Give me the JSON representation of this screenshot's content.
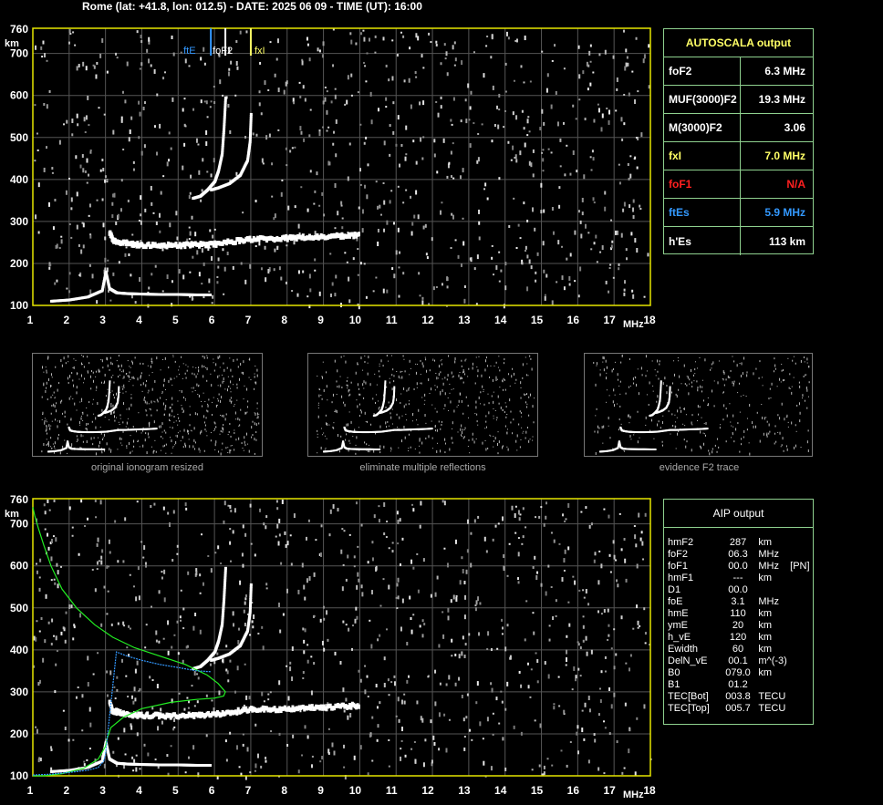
{
  "header": "Rome (lat: +41.8, lon: 012.5) - DATE: 2025 06 09 - TIME (UT): 16:00",
  "colors": {
    "frame": "#e6e600",
    "grid": "#555555",
    "panel": "#8fd18f",
    "yellow": "#ffff66",
    "red": "#ff2020",
    "blue": "#3399ff",
    "green": "#22ee22"
  },
  "chart_data": [
    {
      "type": "scatter",
      "name": "main-ionogram",
      "ylabel": "km",
      "xlabel": "MHz",
      "xlim": [
        1,
        18
      ],
      "ylim": [
        100,
        760
      ],
      "xticks": [
        1,
        2,
        3,
        4,
        5,
        6,
        7,
        8,
        9,
        10,
        11,
        12,
        13,
        14,
        15,
        16,
        17,
        18
      ],
      "yticks": [
        100,
        200,
        300,
        400,
        500,
        600,
        700,
        760
      ],
      "markers": [
        {
          "label": "ftE",
          "x": 5.9,
          "color": "#3399ff"
        },
        {
          "label": "foF2",
          "x": 6.3,
          "color": "#ffffff"
        },
        {
          "label": "fxI",
          "x": 7.0,
          "color": "#ffff66"
        }
      ],
      "traces": [
        {
          "name": "E",
          "x": [
            1.5,
            2,
            2.5,
            2.9,
            3.0,
            3.1,
            3.3,
            3.6,
            4,
            4.5,
            5,
            5.5,
            5.9
          ],
          "y": [
            110,
            113,
            120,
            135,
            180,
            140,
            130,
            128,
            127,
            126,
            126,
            125,
            125
          ]
        },
        {
          "name": "F-low",
          "x": [
            3.1,
            3.2,
            3.4,
            3.7,
            4,
            4.5,
            5,
            5.5,
            6,
            6.5,
            7,
            7.5,
            8,
            8.5,
            9,
            9.5,
            10
          ],
          "y": [
            275,
            255,
            250,
            246,
            244,
            243,
            243,
            244,
            246,
            252,
            258,
            258,
            260,
            262,
            263,
            265,
            268
          ]
        },
        {
          "name": "O-trace",
          "x": [
            5.4,
            5.6,
            5.8,
            6.0,
            6.1,
            6.2,
            6.25,
            6.3
          ],
          "y": [
            355,
            360,
            375,
            395,
            420,
            460,
            520,
            600
          ]
        },
        {
          "name": "X-trace",
          "x": [
            5.9,
            6.1,
            6.4,
            6.7,
            6.9,
            6.97,
            7.0
          ],
          "y": [
            375,
            380,
            390,
            410,
            445,
            490,
            560
          ]
        }
      ]
    },
    {
      "type": "line",
      "name": "aip-profile",
      "ylabel": "km",
      "xlabel": "MHz",
      "xlim": [
        1,
        18
      ],
      "ylim": [
        100,
        760
      ],
      "xticks": [
        1,
        2,
        3,
        4,
        5,
        6,
        7,
        8,
        9,
        10,
        11,
        12,
        13,
        14,
        15,
        16,
        17,
        18
      ],
      "yticks": [
        100,
        200,
        300,
        400,
        500,
        600,
        700,
        760
      ],
      "series": [
        {
          "color": "#22ee22",
          "x": [
            1.0,
            1.05,
            1.15,
            1.3,
            1.5,
            1.8,
            2.2,
            2.7,
            3.2,
            3.8,
            4.5,
            5.2,
            5.8,
            6.1,
            6.3,
            6.25,
            6.0,
            5.5,
            4.8,
            4.0,
            3.5,
            3.15,
            3.05,
            3.0,
            2.8,
            2.4,
            1.8,
            1.3,
            1.0
          ],
          "y": [
            740,
            720,
            690,
            650,
            600,
            545,
            500,
            460,
            430,
            405,
            385,
            365,
            340,
            320,
            300,
            290,
            285,
            282,
            275,
            260,
            240,
            215,
            190,
            170,
            140,
            118,
            105,
            100,
            100
          ]
        },
        {
          "color": "#3399ff",
          "x": [
            1.0,
            1.5,
            2.0,
            2.5,
            2.8,
            2.95,
            3.0,
            3.3,
            3.6,
            4.0,
            4.5,
            5.0,
            5.5,
            5.9
          ],
          "y": [
            102,
            104,
            108,
            113,
            120,
            135,
            150,
            395,
            385,
            375,
            365,
            358,
            350,
            348
          ]
        }
      ],
      "traces": [
        {
          "name": "E",
          "x": [
            1.5,
            2,
            2.5,
            2.9,
            3.0,
            3.1,
            3.3,
            3.6,
            4,
            4.5,
            5,
            5.5,
            5.9
          ],
          "y": [
            110,
            113,
            120,
            135,
            180,
            140,
            130,
            128,
            127,
            126,
            126,
            125,
            125
          ]
        },
        {
          "name": "F-low",
          "x": [
            3.1,
            3.2,
            3.4,
            3.7,
            4,
            4.5,
            5,
            5.5,
            6,
            6.5,
            7,
            7.5,
            8,
            8.5,
            9,
            9.5,
            10
          ],
          "y": [
            275,
            255,
            250,
            246,
            244,
            243,
            243,
            244,
            246,
            252,
            258,
            258,
            260,
            262,
            263,
            265,
            268
          ]
        },
        {
          "name": "O-trace",
          "x": [
            5.4,
            5.6,
            5.8,
            6.0,
            6.1,
            6.2,
            6.25,
            6.3
          ],
          "y": [
            355,
            360,
            375,
            395,
            420,
            460,
            520,
            600
          ]
        },
        {
          "name": "X-trace",
          "x": [
            5.9,
            6.1,
            6.4,
            6.7,
            6.9,
            6.97,
            7.0
          ],
          "y": [
            375,
            380,
            390,
            410,
            445,
            490,
            560
          ]
        }
      ]
    }
  ],
  "thumbs": [
    {
      "caption": "original ionogram resized"
    },
    {
      "caption": "eliminate multiple reflections"
    },
    {
      "caption": "evidence F2 trace"
    }
  ],
  "autoscala": {
    "title": "AUTOSCALA output",
    "rows": [
      {
        "label": "foF2",
        "value": "6.3 MHz",
        "color": "#ffffff"
      },
      {
        "label": "MUF(3000)F2",
        "value": "19.3 MHz",
        "color": "#ffffff"
      },
      {
        "label": "M(3000)F2",
        "value": "3.06",
        "color": "#ffffff"
      },
      {
        "label": "fxI",
        "value": "7.0 MHz",
        "color": "#ffff66"
      },
      {
        "label": "foF1",
        "value": "N/A",
        "color": "#ff2020"
      },
      {
        "label": "ftEs",
        "value": "5.9 MHz",
        "color": "#3399ff"
      },
      {
        "label": "h'Es",
        "value": "113    km",
        "color": "#ffffff"
      }
    ]
  },
  "aip": {
    "title": "AIP output",
    "rows": [
      [
        "hmF2",
        "287",
        "km",
        ""
      ],
      [
        "foF2",
        "06.3",
        "MHz",
        ""
      ],
      [
        "foF1",
        "00.0",
        "MHz",
        "[PN]"
      ],
      [
        "hmF1",
        "---",
        "km",
        ""
      ],
      [
        "D1",
        "00.0",
        "",
        ""
      ],
      [
        "foE",
        "3.1",
        "MHz",
        ""
      ],
      [
        "hmE",
        "110",
        "km",
        ""
      ],
      [
        "ymE",
        "20",
        "km",
        ""
      ],
      [
        "h_vE",
        "120",
        "km",
        ""
      ],
      [
        "Ewidth",
        "60",
        "km",
        ""
      ],
      [
        "DelN_vE",
        "00.1",
        "m^(-3)",
        ""
      ],
      [
        "B0",
        "079.0",
        "km",
        ""
      ],
      [
        "B1",
        "01.2",
        "",
        ""
      ],
      [
        "TEC[Bot]",
        "003.8",
        "TECU",
        ""
      ],
      [
        "TEC[Top]",
        "005.7",
        "TECU",
        ""
      ]
    ]
  }
}
